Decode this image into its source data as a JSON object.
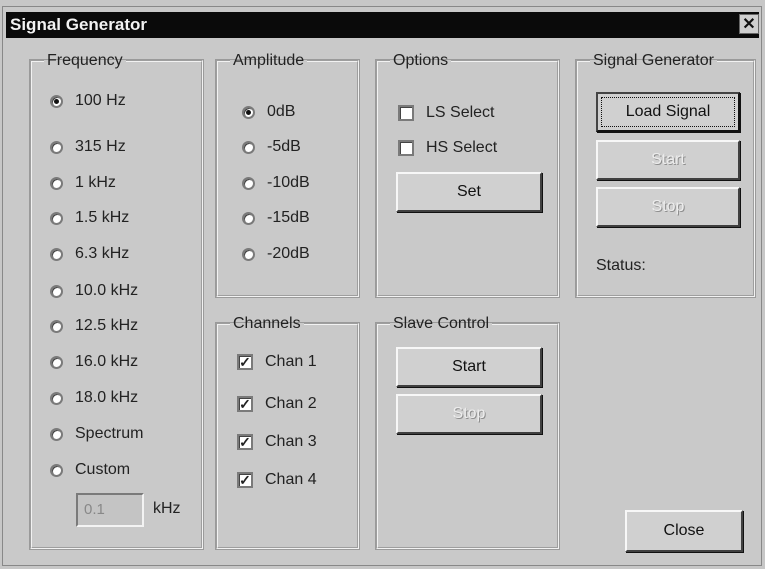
{
  "window": {
    "title": "Signal Generator",
    "close_label": "✕"
  },
  "frequency": {
    "legend": "Frequency",
    "options": [
      "100 Hz",
      "315 Hz",
      "1 kHz",
      "1.5 kHz",
      "6.3 kHz",
      "10.0 kHz",
      "12.5 kHz",
      "16.0 kHz",
      "18.0 kHz",
      "Spectrum",
      "Custom"
    ],
    "selected": "100 Hz",
    "custom_value": "0.1",
    "unit": "kHz"
  },
  "amplitude": {
    "legend": "Amplitude",
    "options": [
      "0dB",
      "-5dB",
      "-10dB",
      "-15dB",
      "-20dB"
    ],
    "selected": "0dB"
  },
  "options": {
    "legend": "Options",
    "ls_select": "LS Select",
    "hs_select": "HS Select",
    "set_label": "Set"
  },
  "signal_generator": {
    "legend": "Signal Generator",
    "load_label": "Load Signal",
    "start_label": "Start",
    "stop_label": "Stop",
    "status_label": "Status:"
  },
  "channels": {
    "legend": "Channels",
    "items": [
      "Chan 1",
      "Chan 2",
      "Chan 3",
      "Chan 4"
    ],
    "checked_mark": "✓"
  },
  "slave_control": {
    "legend": "Slave Control",
    "start_label": "Start",
    "stop_label": "Stop"
  },
  "footer": {
    "close_label": "Close"
  }
}
